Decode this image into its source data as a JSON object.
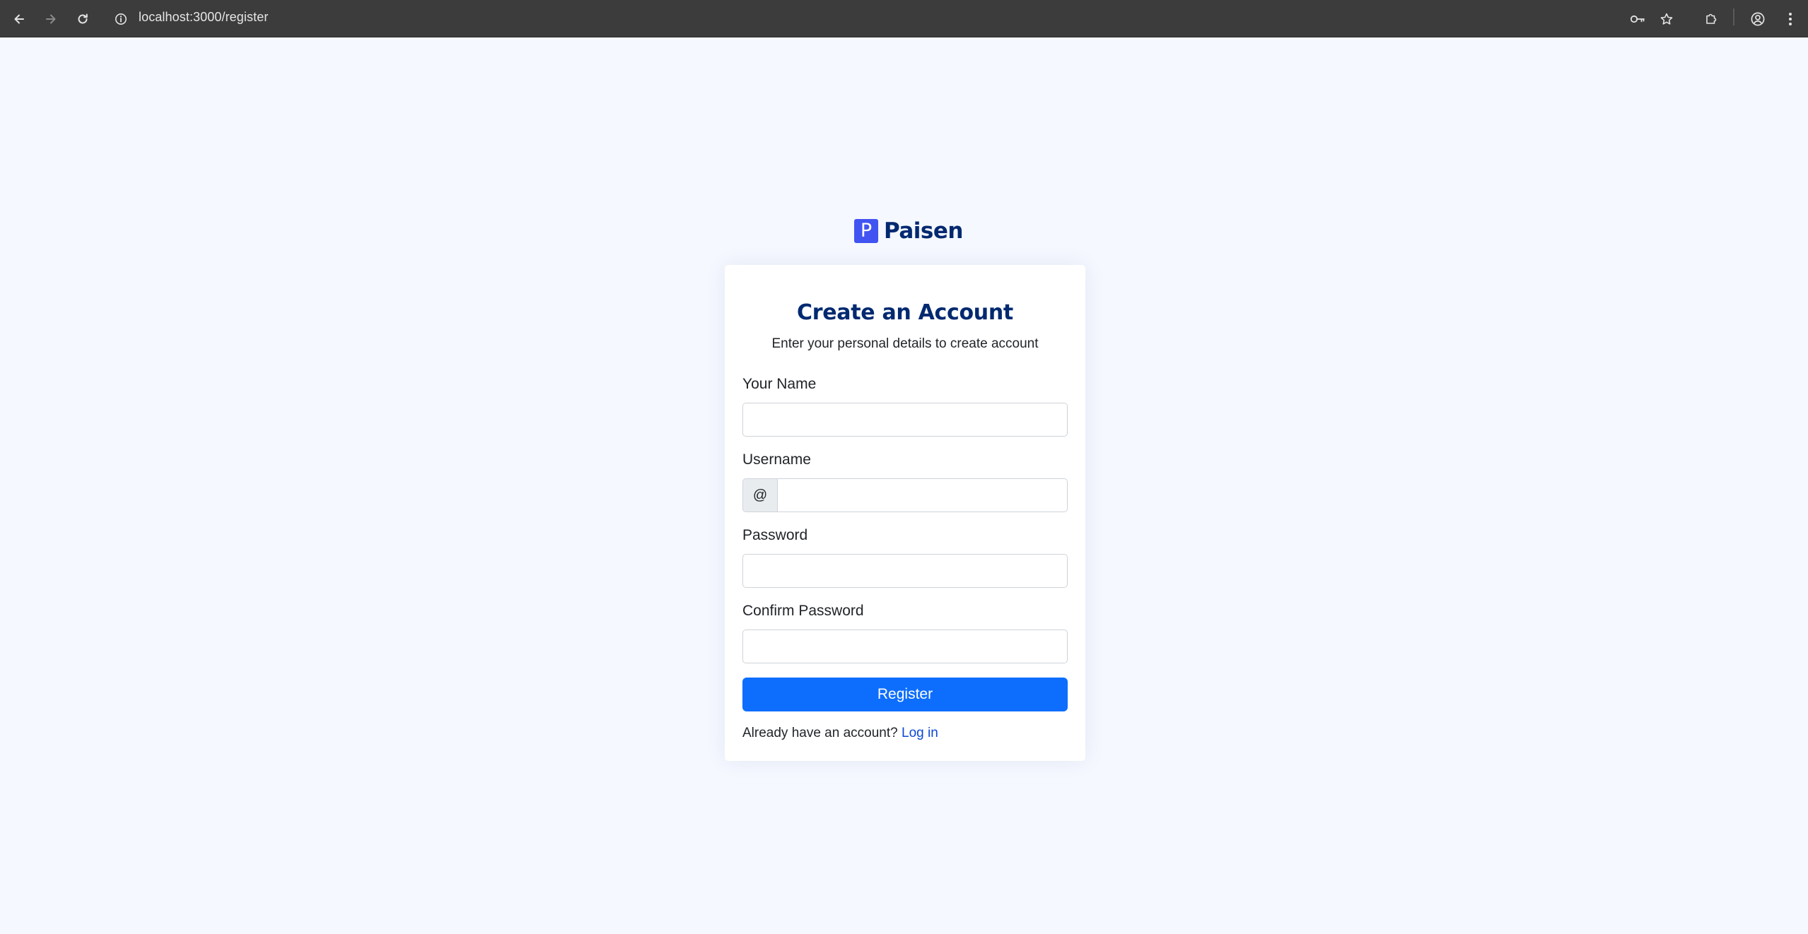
{
  "browser": {
    "url": "localhost:3000/register",
    "icons": [
      "back-arrow-icon",
      "forward-arrow-icon",
      "reload-icon",
      "site-info-icon",
      "password-key-icon",
      "bookmark-star-icon",
      "extensions-icon",
      "profile-icon",
      "menu-dots-icon"
    ]
  },
  "brand": {
    "mark": "P",
    "name": "Paisen",
    "color": "#4154f1"
  },
  "card": {
    "title": "Create an Account",
    "subtitle": "Enter your personal details to create account"
  },
  "form": {
    "name_label": "Your Name",
    "name_value": "",
    "username_label": "Username",
    "username_prefix": "@",
    "username_value": "",
    "password_label": "Password",
    "password_value": "",
    "confirm_label": "Confirm Password",
    "confirm_value": "",
    "submit_label": "Register",
    "submit_color": "#0d6efd"
  },
  "footer": {
    "prompt": "Already have an account?",
    "link_label": "Log in"
  }
}
